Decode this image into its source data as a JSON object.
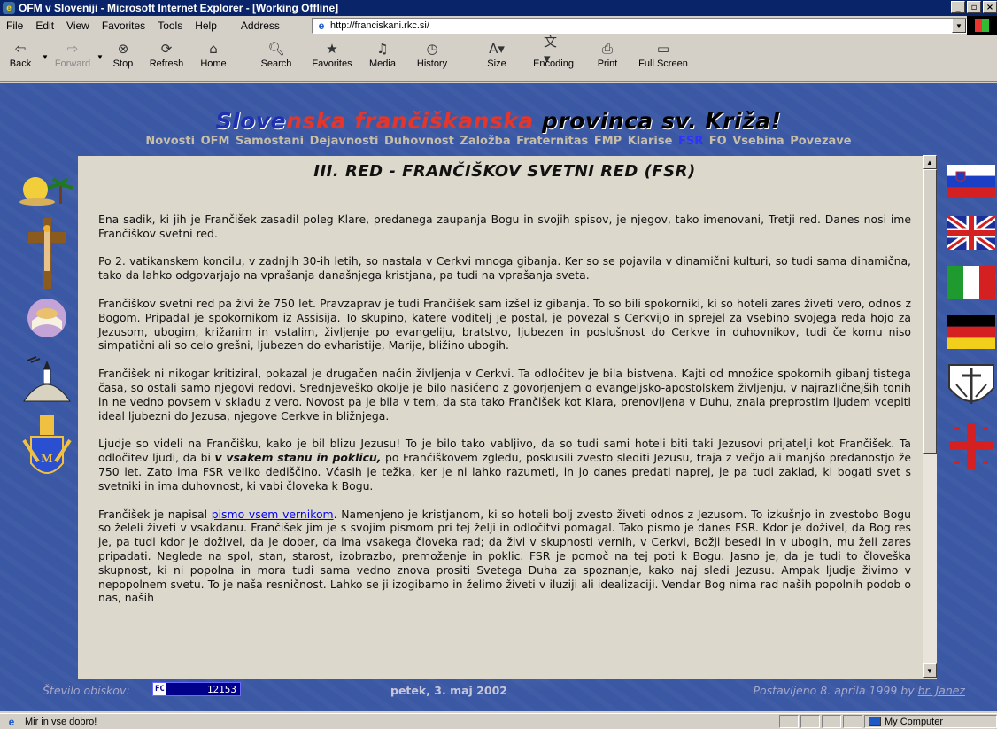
{
  "window": {
    "title": "OFM v Sloveniji - Microsoft Internet Explorer - [Working Offline]"
  },
  "menu": {
    "items": [
      "File",
      "Edit",
      "View",
      "Favorites",
      "Tools",
      "Help"
    ],
    "address_label": "Address"
  },
  "address": {
    "url": "http://franciskani.rkc.si/"
  },
  "toolbar": {
    "back": "Back",
    "forward": "Forward",
    "stop": "Stop",
    "refresh": "Refresh",
    "home": "Home",
    "search": "Search",
    "favorites": "Favorites",
    "media": "Media",
    "history": "History",
    "size": "Size",
    "encoding": "Encoding",
    "print": "Print",
    "fullscreen": "Full Screen"
  },
  "site": {
    "title_part1": "Slove",
    "title_part2": "nska ",
    "title_part3": "frančiškanska ",
    "title_part4": "provinca sv. Križa!",
    "nav": [
      "Novosti",
      "OFM",
      "Samostani",
      "Dejavnosti",
      "Duhovnost",
      "Založba",
      "Fraternitas",
      "FMP",
      "Klarise",
      "FSR",
      "FO",
      "Vsebina",
      "Povezave"
    ],
    "nav_active": "FSR"
  },
  "article": {
    "heading": "III. RED - FRANČIŠKOV SVETNI RED (FSR)",
    "p1": "Ena sadik, ki jih je Frančišek zasadil poleg Klare, predanega zaupanja Bogu in svojih spisov, je njegov, tako imenovani, Tretji red. Danes nosi ime Frančiškov svetni red.",
    "p2": "Po 2. vatikanskem koncilu, v zadnjih 30-ih letih, so nastala v Cerkvi mnoga gibanja. Ker so se pojavila v dinamični kulturi, so tudi sama dinamična, tako da lahko odgovarjajo na vprašanja današnjega kristjana, pa tudi na vprašanja sveta.",
    "p3": "Frančiškov svetni red pa živi že 750 let. Pravzaprav je tudi Frančišek sam izšel iz gibanja. To so bili spokorniki, ki so hoteli zares živeti vero, odnos z Bogom. Pripadal je spokornikom iz Assisija. To skupino, katere voditelj je postal, je povezal s Cerkvijo in sprejel za vsebino svojega reda hojo za Jezusom, ubogim, križanim in vstalim, življenje po evangeliju, bratstvo, ljubezen in poslušnost do Cerkve in duhovnikov, tudi če komu niso simpatični ali so celo grešni, ljubezen do evharistije, Marije, bližino ubogih.",
    "p4": "Frančišek ni nikogar kritiziral, pokazal je drugačen način življenja v Cerkvi. Ta odločitev je bila bistvena. Kajti od množice spokornih gibanj tistega časa, so ostali samo njegovi redovi. Srednjeveško okolje je bilo nasičeno z govorjenjem o evangeljsko-apostolskem življenju, v najrazličnejših tonih in ne vedno povsem v skladu z vero. Novost pa je bila v tem, da sta tako Frančišek kot Klara, prenovljena v Duhu, znala preprostim ljudem vcepiti ideal ljubezni do Jezusa, njegove Cerkve in bližnjega.",
    "p5a": "Ljudje so videli na Frančišku, kako je bil blizu Jezusu! To je bilo tako vabljivo, da so tudi sami hoteli biti taki Jezusovi prijatelji kot Frančišek. Ta odločitev ljudi, da bi ",
    "p5b": "v vsakem stanu in poklicu,",
    "p5c": " po Frančiškovem zgledu, poskusili zvesto slediti Jezusu, traja z večjo ali manjšo predanostjo že 750 let. Zato ima FSR veliko dediščino. Včasih je težka, ker je ni lahko razumeti, in jo danes predati naprej, je pa tudi zaklad, ki bogati svet s svetniki in ima duhovnost, ki vabi človeka k Bogu.",
    "p6a": "Frančišek je napisal ",
    "p6link": "pismo vsem vernikom",
    "p6b": ". Namenjeno je kristjanom, ki so hoteli bolj zvesto živeti odnos z Jezusom. To izkušnjo in zvestobo Bogu so želeli živeti v vsakdanu. Frančišek jim je s svojim pismom pri tej želji in odločitvi pomagal. Tako pismo je danes FSR. Kdor je doživel, da Bog res je, pa tudi kdor je doživel, da je dober, da ima vsakega človeka rad; da živi v skupnosti vernih, v Cerkvi, Božji besedi in v ubogih, mu želi zares pripadati. Neglede na spol, stan, starost, izobrazbo, premoženje in poklic. FSR je pomoč na tej poti k Bogu. Jasno je, da je tudi to človeška skupnost, ki ni popolna in mora tudi sama vedno znova prositi Svetega Duha za spoznanje, kako naj sledi Jezusu. Ampak ljudje živimo v nepopolnem svetu. To je naša resničnost. Lahko se ji izogibamo in želimo živeti v iluziji ali idealizaciji. Vendar Bog nima rad naših popolnih podob o nas, naših"
  },
  "footer": {
    "visits_label": "Število obiskov:",
    "counter_badge": "FC",
    "counter_value": "12153",
    "date": "petek, 3. maj 2002",
    "posted": "Postavljeno 8. aprila 1999 by ",
    "posted_author": "br. Janez"
  },
  "status": {
    "text": "Mir in vse dobro!",
    "zone": "My Computer"
  }
}
